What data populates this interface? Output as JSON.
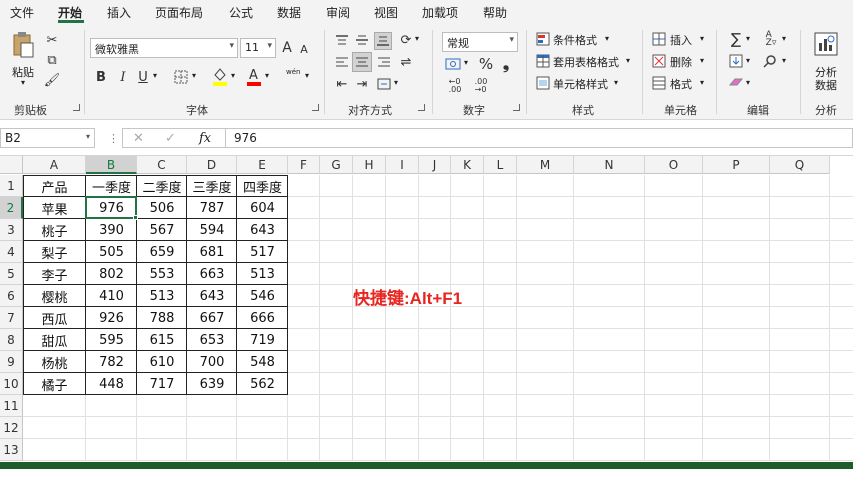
{
  "tabs": [
    "文件",
    "开始",
    "插入",
    "页面布局",
    "公式",
    "数据",
    "审阅",
    "视图",
    "加载项",
    "帮助"
  ],
  "active_tab": "开始",
  "ribbon": {
    "clipboard": {
      "paste": "粘贴",
      "label": "剪贴板"
    },
    "font": {
      "name": "微软雅黑",
      "size": "11",
      "label": "字体",
      "bold": "B",
      "italic": "I",
      "underline": "U",
      "grow": "A",
      "shrink": "A",
      "wen": "wén",
      "fill_color": "#ffff00",
      "font_color": "#ff0000"
    },
    "alignment": {
      "label": "对齐方式"
    },
    "number": {
      "format": "常规",
      "percent": "%",
      "label": "数字"
    },
    "styles": {
      "conditional": "条件格式",
      "table": "套用表格格式",
      "cell": "单元格样式",
      "label": "样式"
    },
    "cells": {
      "insert": "插入",
      "delete": "删除",
      "format": "格式",
      "label": "单元格"
    },
    "editing": {
      "label": "编辑"
    },
    "analysis": {
      "line1": "分析",
      "line2": "数据",
      "label": "分析"
    }
  },
  "formula_bar": {
    "name_box": "B2",
    "fx": "fx",
    "value": "976"
  },
  "columns": [
    "A",
    "B",
    "C",
    "D",
    "E",
    "F",
    "G",
    "H",
    "I",
    "J",
    "K",
    "L",
    "M",
    "N",
    "O",
    "P",
    "Q"
  ],
  "rows": [
    "1",
    "2",
    "3",
    "4",
    "5",
    "6",
    "7",
    "8",
    "9",
    "10",
    "11",
    "12",
    "13"
  ],
  "table": {
    "header": [
      "产品",
      "一季度",
      "二季度",
      "三季度",
      "四季度"
    ],
    "rows": [
      [
        "苹果",
        "976",
        "506",
        "787",
        "604"
      ],
      [
        "桃子",
        "390",
        "567",
        "594",
        "643"
      ],
      [
        "梨子",
        "505",
        "659",
        "681",
        "517"
      ],
      [
        "李子",
        "802",
        "553",
        "663",
        "513"
      ],
      [
        "樱桃",
        "410",
        "513",
        "643",
        "546"
      ],
      [
        "西瓜",
        "926",
        "788",
        "667",
        "666"
      ],
      [
        "甜瓜",
        "595",
        "615",
        "653",
        "719"
      ],
      [
        "杨桃",
        "782",
        "610",
        "700",
        "548"
      ],
      [
        "橘子",
        "448",
        "717",
        "639",
        "562"
      ]
    ]
  },
  "shortcut_text": "快捷键:Alt+F1",
  "colors": {
    "accent": "#217346",
    "shortcut": "#e8251f"
  }
}
